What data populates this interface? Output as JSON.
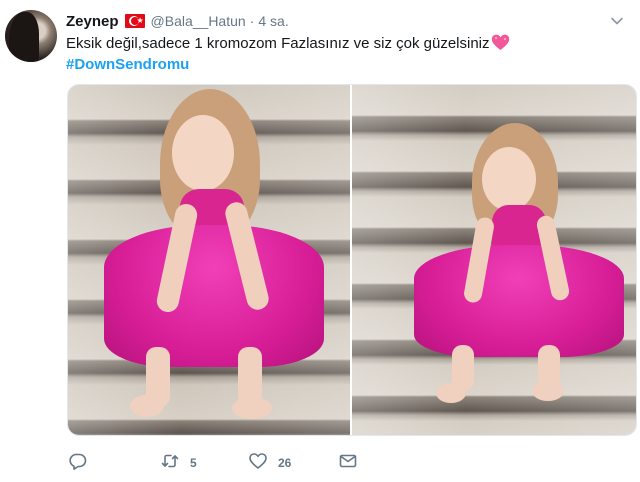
{
  "tweet": {
    "author_name": "Zeynep",
    "author_handle": "@Bala__Hatun",
    "separator": "·",
    "time": "4 sa.",
    "text": "Eksik değil,sadece 1 kromozom Fazlasınız ve siz çok güzelsiniz",
    "hashtag": "#DownSendromu"
  },
  "icons": {
    "flag": "turkey-flag-icon",
    "emoji": "sparkling-heart-icon",
    "more": "chevron-down-icon",
    "reply": "reply-icon",
    "retweet": "retweet-icon",
    "like": "heart-icon",
    "dm": "envelope-icon"
  },
  "actions": {
    "retweet_count": "5",
    "like_count": "26"
  },
  "colors": {
    "link": "#1da1f2",
    "muted": "#657786",
    "text": "#14171a",
    "dress": "#e02aa0"
  }
}
